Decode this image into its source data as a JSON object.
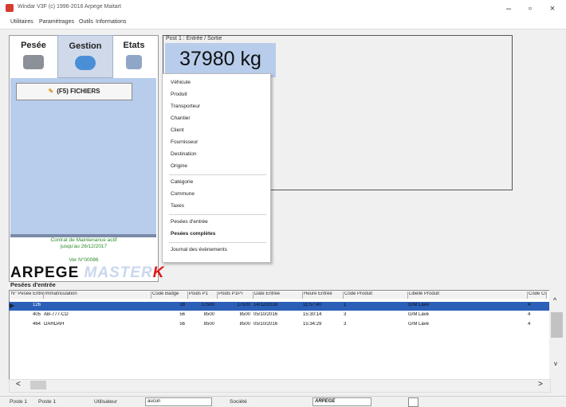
{
  "window": {
    "title": "Windar V3F (c) 1996-2016 Arpege Maitart",
    "minimize": "–",
    "maximize": "▫",
    "close": "×"
  },
  "menu": [
    "Utilitaires",
    "Paramétrages",
    "Outils",
    "Informations"
  ],
  "nav": [
    {
      "label": "Pesée",
      "icon": "scale-icon"
    },
    {
      "label": "Gestion",
      "icon": "folder-icon"
    },
    {
      "label": "Etats",
      "icon": "printer-icon"
    }
  ],
  "side": {
    "fichiers_button": "(F5) FICHIERS",
    "contract_line1": "Contrat de Maintenance actif",
    "contract_line2": "jusqu'au 26/12/2017",
    "version": "Ver N°00086",
    "logo_a": "ARPEGE",
    "logo_m": "MASTER",
    "logo_k": "K"
  },
  "weighing": {
    "poste": "Post 1 : Entrée / Sortie",
    "weight": "37980 kg"
  },
  "dropdown": {
    "group1": [
      "Véhicule",
      "Produit",
      "Transporteur",
      "Chantier",
      "Client",
      "Fournisseur",
      "Destination",
      "Origine"
    ],
    "group2": [
      "Catégorie",
      "Commune",
      "Taxes"
    ],
    "group3": [
      "Pesées d'entrée",
      "Pesées complètes"
    ],
    "group4": [
      "Journal des évènements"
    ]
  },
  "grid": {
    "title": "Pesées d'entrée",
    "columns": [
      "N° Pesée Entrée",
      "Immatriculation",
      "Code Badge",
      "Poids P1",
      "Poids P1PT",
      "Date Entrée",
      "Heure Entrée",
      "Code Produit",
      "Libellé Produit",
      "Code Cl"
    ],
    "rows": [
      [
        "126",
        "",
        "28",
        "17500",
        "17500",
        "14/12/2016",
        "11:57:40",
        "1",
        "G/M Lavé",
        "4"
      ],
      [
        "405",
        "AB-777-CD",
        "56",
        "8500",
        "8500",
        "05/10/2016",
        "15:30:14",
        "3",
        "G/M Lavé",
        "4"
      ],
      [
        "464",
        "DAHDAH",
        "56",
        "8500",
        "8500",
        "05/10/2016",
        "15:34:29",
        "3",
        "G/M Lavé",
        "4"
      ]
    ]
  },
  "scroll": {
    "up": "^",
    "down": "v",
    "left": "<",
    "right": ">"
  },
  "status": {
    "poste_label": "Poste 1",
    "poste_value": "Poste 1",
    "user_label": "Utilisateur",
    "user_value": "aucun",
    "company_label": "Société",
    "company_value": "ARPEGE"
  }
}
